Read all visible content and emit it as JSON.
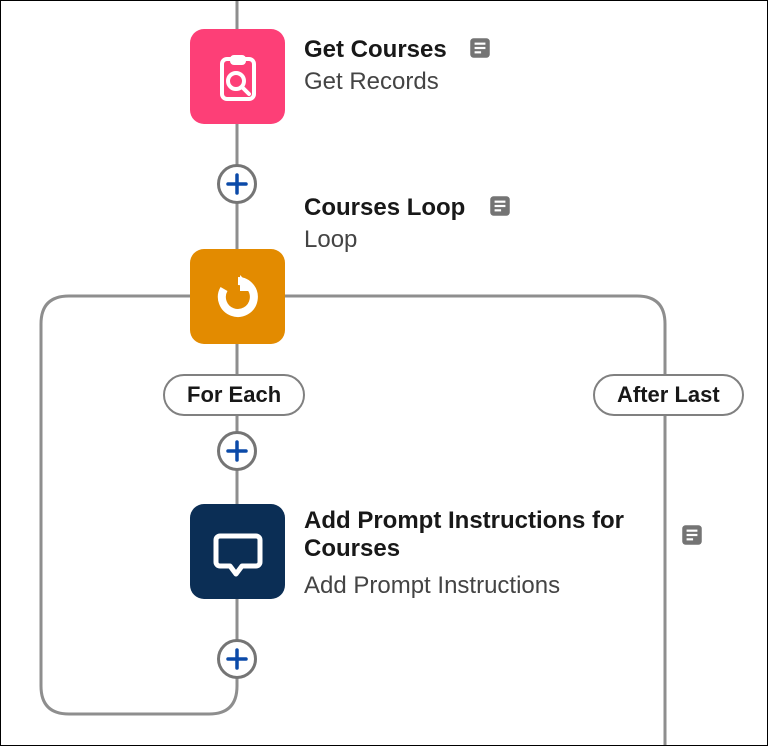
{
  "nodes": {
    "getCourses": {
      "title": "Get Courses",
      "subtitle": "Get Records"
    },
    "coursesLoop": {
      "title": "Courses Loop",
      "subtitle": "Loop"
    },
    "addPrompt": {
      "title": "Add Prompt Instructions for Courses",
      "subtitle": "Add Prompt Instructions"
    }
  },
  "badges": {
    "forEach": "For Each",
    "afterLast": "After Last"
  },
  "colors": {
    "getCourses": "#fd3f77",
    "loop": "#e38b00",
    "addPrompt": "#0b2e55",
    "plus": "#0b4aa8",
    "connector": "#8e8e8e"
  }
}
